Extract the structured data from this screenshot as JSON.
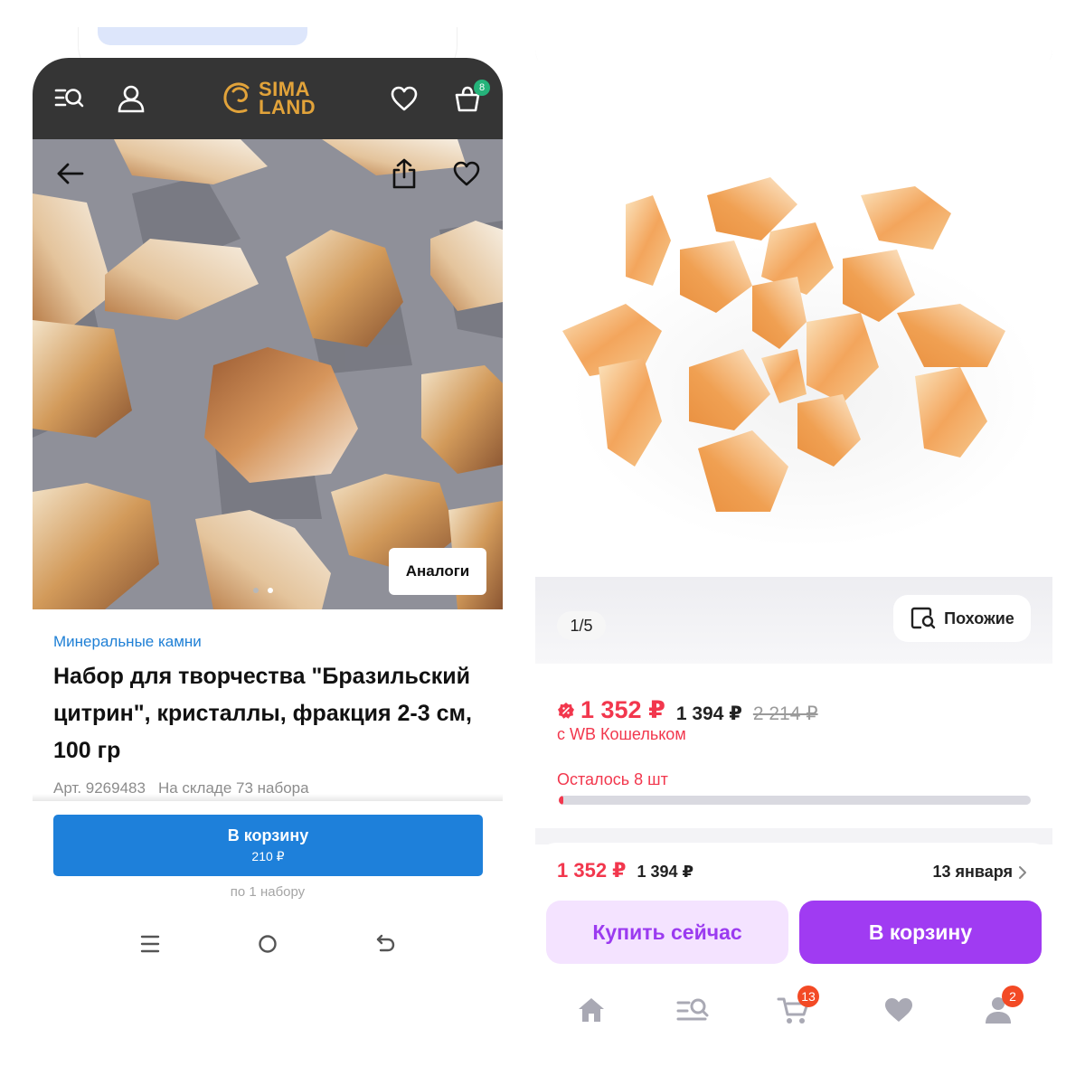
{
  "left": {
    "logo": {
      "line1": "SIMA",
      "line2": "LAND"
    },
    "cart_count": "8",
    "analogs_button": "Аналоги",
    "gallery": {
      "count": 2,
      "active": 2
    },
    "category": "Минеральные камни",
    "title": "Набор для творчества \"Бразильский цитрин\", кристаллы, фракция 2-3 см, 100 гр",
    "article": "Арт. 9269483",
    "stock": "На складе 73 набора",
    "cart_button": {
      "label": "В корзину",
      "price": "210 ₽"
    },
    "per_unit": "по 1 набору",
    "colors": {
      "header": "#353535",
      "accent": "#1e80da",
      "logo": "#e2a33a",
      "badge": "#25b37a"
    },
    "icons": [
      "catalog-search-icon",
      "user-icon",
      "heart-icon",
      "cart-icon",
      "back-arrow-icon",
      "share-icon",
      "heart-outline-icon",
      "menu-icon",
      "home-circle-icon",
      "back-icon"
    ]
  },
  "right": {
    "gallery_counter": "1/5",
    "similar_button": "Похожие",
    "price": "1 352 ₽",
    "price_old": "1 394 ₽",
    "price_strike": "2 214 ₽",
    "wallet_note": "с WB Кошельком",
    "stock_left": "Осталось 8 шт",
    "stock_fraction": 0.01,
    "buy_row": {
      "price": "1 352 ₽",
      "old_price": "1 394 ₽",
      "delivery": "13 января"
    },
    "buy_now_button": "Купить сейчас",
    "to_cart_button": "В корзину",
    "nav": {
      "cart_badge": "13",
      "profile_badge": "2"
    },
    "colors": {
      "price": "#f2374d",
      "primary": "#a03bf2",
      "secondary_bg": "#f4e3ff",
      "badge": "#f34a25"
    },
    "icons": [
      "discount-icon",
      "search-similar-icon",
      "chevron-right-icon",
      "home-icon",
      "catalog-icon",
      "cart-icon",
      "heart-icon",
      "profile-icon"
    ]
  }
}
